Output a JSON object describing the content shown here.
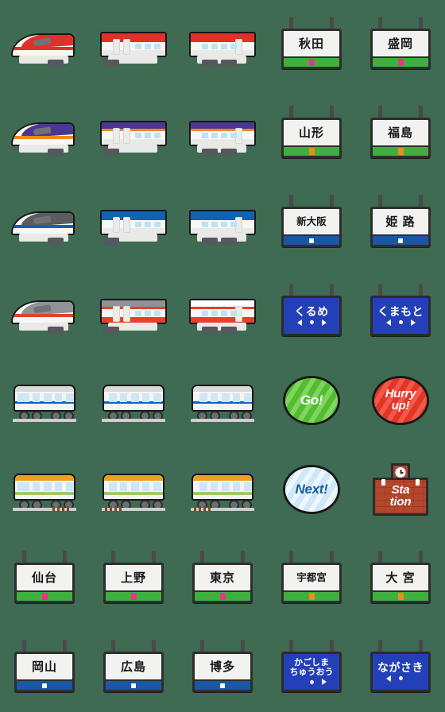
{
  "page": {
    "background_color": "#3e6b51",
    "title": "Shinkansen and station sign emoji sheet",
    "columns": 5,
    "rows": 8
  },
  "palette": {
    "green_bar": "#3fb03f",
    "blue_bar": "#1b57a5",
    "pink_marker": "#e5368a",
    "orange_marker": "#ef8a1b",
    "led_blue": "#2440b8",
    "brick_red": "#b4462c",
    "bubble_green": "#63c83f",
    "bubble_red": "#ee4433",
    "bubble_lightblue": "#dff0fb",
    "outline": "#17171a"
  },
  "cells": [
    {
      "id": "r1c1",
      "kind": "train-nose",
      "name": "red-shinkansen-nose",
      "accent": "#e03127",
      "roof": "#e03127",
      "sub": "#6f7276"
    },
    {
      "id": "r1c2",
      "kind": "train-mid",
      "name": "red-shinkansen-middle",
      "accent": "#e03127",
      "roof": "#e03127"
    },
    {
      "id": "r1c3",
      "kind": "train-end",
      "name": "red-shinkansen-end",
      "accent": "#e03127",
      "roof": "#e03127"
    },
    {
      "id": "r1c4",
      "kind": "sign",
      "name": "station-sign-akita",
      "label": "秋田",
      "bar": "green",
      "marker": "pink"
    },
    {
      "id": "r1c5",
      "kind": "sign",
      "name": "station-sign-morioka",
      "label": "盛岡",
      "bar": "green",
      "marker": "pink"
    },
    {
      "id": "r2c1",
      "kind": "train-nose",
      "name": "purple-shinkansen-nose",
      "accent": "#f08a1c",
      "roof": "#4b3793",
      "sub": "#6f7276"
    },
    {
      "id": "r2c2",
      "kind": "train-mid",
      "name": "purple-shinkansen-middle",
      "accent": "#f08a1c",
      "roof": "#4b3793"
    },
    {
      "id": "r2c3",
      "kind": "train-end",
      "name": "purple-shinkansen-end",
      "accent": "#f08a1c",
      "roof": "#4b3793"
    },
    {
      "id": "r2c4",
      "kind": "sign",
      "name": "station-sign-yamagata",
      "label": "山形",
      "bar": "green",
      "marker": "orange"
    },
    {
      "id": "r2c5",
      "kind": "sign",
      "name": "station-sign-fukushima",
      "label": "福島",
      "bar": "green",
      "marker": "orange"
    },
    {
      "id": "r3c1",
      "kind": "train-nose",
      "name": "blue-shinkansen-nose",
      "accent": "#1262b3",
      "roof": "#5a5c60",
      "sub": "#6f7276"
    },
    {
      "id": "r3c2",
      "kind": "train-mid",
      "name": "blue-shinkansen-middle",
      "accent": "#1262b3",
      "roof": "#1262b3"
    },
    {
      "id": "r3c3",
      "kind": "train-end",
      "name": "blue-shinkansen-end",
      "accent": "#1262b3",
      "roof": "#1262b3"
    },
    {
      "id": "r3c4",
      "kind": "sign",
      "name": "station-sign-shin-osaka",
      "label": "新大阪",
      "bar": "blue",
      "marker": "white",
      "long": true
    },
    {
      "id": "r3c5",
      "kind": "sign",
      "name": "station-sign-himeji",
      "label": "姫 路",
      "bar": "blue",
      "marker": "white"
    },
    {
      "id": "r4c1",
      "kind": "train-nose",
      "name": "white-red-shinkansen-nose",
      "accent": "#e8402b",
      "roof": "#8f9297",
      "sub": "#6f7276"
    },
    {
      "id": "r4c2",
      "kind": "train-mid",
      "name": "white-red-shinkansen-middle",
      "accent": "#e8402b",
      "roof": "#8f9297"
    },
    {
      "id": "r4c3",
      "kind": "train-end",
      "name": "white-red-shinkansen-end",
      "accent": "#e8402b",
      "roof": "#ffffff"
    },
    {
      "id": "r4c4",
      "kind": "led",
      "name": "led-sign-kurume",
      "label": "くるめ",
      "arrows": [
        "left",
        "dot",
        "right"
      ]
    },
    {
      "id": "r4c5",
      "kind": "led",
      "name": "led-sign-kumamoto",
      "label": "くまもと",
      "arrows": [
        "left",
        "dot",
        "right"
      ]
    },
    {
      "id": "r5c1",
      "kind": "commuter-front",
      "name": "white-commuter-front",
      "accent": "#1064c0",
      "roof": "#d9d9d6"
    },
    {
      "id": "r5c2",
      "kind": "commuter-pair",
      "name": "white-commuter-pair",
      "accent": "#1064c0",
      "roof": "#d9d9d6"
    },
    {
      "id": "r5c3",
      "kind": "commuter-rear",
      "name": "white-commuter-rear",
      "accent": "#1064c0",
      "roof": "#d9d9d6"
    },
    {
      "id": "r5c4",
      "kind": "bubble",
      "name": "speech-bubble-go",
      "label": "Go!",
      "theme": "bub-green"
    },
    {
      "id": "r5c5",
      "kind": "bubble",
      "name": "speech-bubble-hurry-up",
      "label": "Hurry\nup!",
      "theme": "bub-red",
      "small": true
    },
    {
      "id": "r6c1",
      "kind": "local-front",
      "name": "orange-local-front",
      "accent": "#f0a021",
      "roof": "#f0a021"
    },
    {
      "id": "r6c2",
      "kind": "local-pair",
      "name": "orange-local-pair",
      "accent": "#f0a021",
      "roof": "#f0a021"
    },
    {
      "id": "r6c3",
      "kind": "local-rear",
      "name": "orange-local-rear",
      "accent": "#f0a021",
      "roof": "#f0a021"
    },
    {
      "id": "r6c4",
      "kind": "bubble",
      "name": "speech-bubble-next",
      "label": "Next!",
      "theme": "bub-blue"
    },
    {
      "id": "r6c5",
      "kind": "building",
      "name": "station-building",
      "label": "Sta\ntion"
    },
    {
      "id": "r7c1",
      "kind": "sign",
      "name": "station-sign-sendai",
      "label": "仙台",
      "bar": "green",
      "marker": "pink"
    },
    {
      "id": "r7c2",
      "kind": "sign",
      "name": "station-sign-ueno",
      "label": "上野",
      "bar": "green",
      "marker": "pink"
    },
    {
      "id": "r7c3",
      "kind": "sign",
      "name": "station-sign-tokyo",
      "label": "東京",
      "bar": "green",
      "marker": "pink"
    },
    {
      "id": "r7c4",
      "kind": "sign",
      "name": "station-sign-utsunomiya",
      "label": "宇都宮",
      "bar": "green",
      "marker": "orange",
      "long": true
    },
    {
      "id": "r7c5",
      "kind": "sign",
      "name": "station-sign-omiya",
      "label": "大 宮",
      "bar": "green",
      "marker": "orange"
    },
    {
      "id": "r8c1",
      "kind": "sign",
      "name": "station-sign-okayama",
      "label": "岡山",
      "bar": "blue",
      "marker": "white"
    },
    {
      "id": "r8c2",
      "kind": "sign",
      "name": "station-sign-hiroshima",
      "label": "広島",
      "bar": "blue",
      "marker": "white"
    },
    {
      "id": "r8c3",
      "kind": "sign",
      "name": "station-sign-hakata",
      "label": "博多",
      "bar": "blue",
      "marker": "white"
    },
    {
      "id": "r8c4",
      "kind": "led",
      "name": "led-sign-kagoshima-chuo",
      "label": "かごしま\nちゅうおう",
      "two_line": true,
      "arrows": [
        "none",
        "dot",
        "right"
      ]
    },
    {
      "id": "r8c5",
      "kind": "led",
      "name": "led-sign-nagasaki",
      "label": "ながさき",
      "arrows": [
        "left",
        "dot",
        "none"
      ]
    }
  ]
}
